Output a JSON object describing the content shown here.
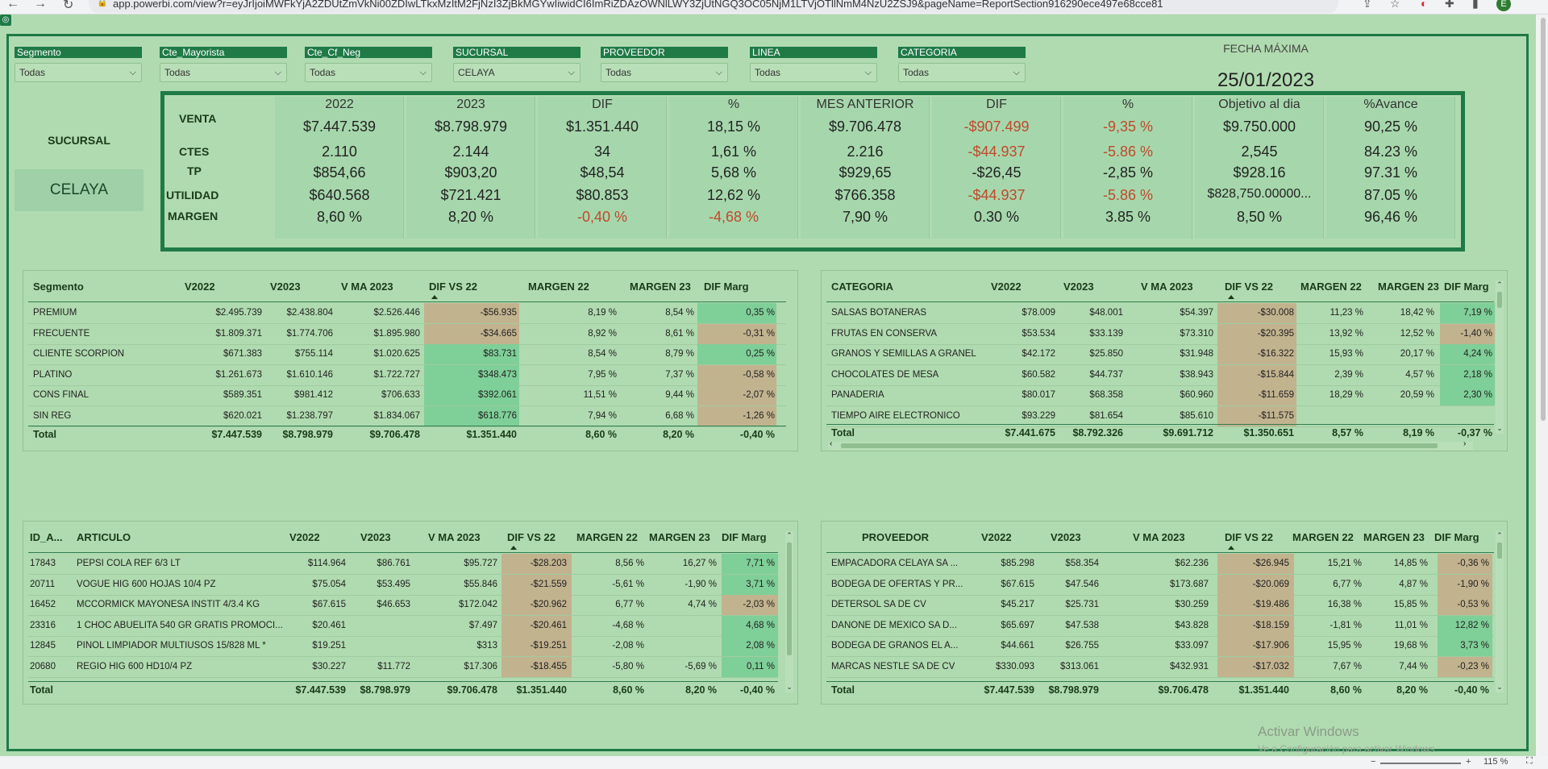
{
  "browser": {
    "url": "app.powerbi.com/view?r=eyJrIjoiMWFkYjA2ZDUtZmVkNi00ZDIwLTkxMzItM2FjNzI3ZjBkMGYwIiwidCI6ImRiZDAzOWNlLWY3ZjUtNGQ3OC05NjM1LTVjOTllNmM4NzU2ZSJ9&pageName=ReportSection916290ece497e68cce81",
    "avatar_letter": "E",
    "zoom": "115 %"
  },
  "slicers": [
    {
      "label": "Segmento",
      "value": "Todas"
    },
    {
      "label": "Cte_Mayorista",
      "value": "Todas"
    },
    {
      "label": "Cte_Cf_Neg",
      "value": "Todas"
    },
    {
      "label": "SUCURSAL",
      "value": "CELAYA"
    },
    {
      "label": "PROVEEDOR",
      "value": "Todas"
    },
    {
      "label": "LINEA",
      "value": "Todas"
    },
    {
      "label": "CATEGORIA",
      "value": "Todas"
    }
  ],
  "fecha": {
    "label": "FECHA MÁXIMA",
    "value": "25/01/2023"
  },
  "sucursal": {
    "label": "SUCURSAL",
    "value": "CELAYA"
  },
  "kpi": {
    "headers": [
      "2022",
      "2023",
      "DIF",
      "%",
      "MES ANTERIOR",
      "DIF",
      "%",
      "Objetivo al dia",
      "%Avance"
    ],
    "rows": [
      {
        "label": "VENTA",
        "values": [
          "$7.447.539",
          "$8.798.979",
          "$1.351.440",
          "18,15 %",
          "$9.706.478",
          "-$907.499",
          "-9,35 %",
          "$9.750.000",
          "90,25 %"
        ],
        "neg": [
          false,
          false,
          false,
          false,
          false,
          true,
          true,
          false,
          false
        ]
      },
      {
        "label": "CTES",
        "values": [
          "2.110",
          "2.144",
          "34",
          "1,61 %",
          "2.216",
          "-$44.937",
          "-5.86 %",
          "2,545",
          "84.23 %"
        ],
        "neg": [
          false,
          false,
          false,
          false,
          false,
          true,
          true,
          false,
          false
        ]
      },
      {
        "label": "TP",
        "values": [
          "$854,66",
          "$903,20",
          "$48,54",
          "5,68 %",
          "$929,65",
          "-$26,45",
          "-2,85 %",
          "$928.16",
          "97.31 %"
        ],
        "neg": [
          false,
          false,
          false,
          false,
          false,
          false,
          false,
          false,
          false
        ]
      },
      {
        "label": "UTILIDAD",
        "values": [
          "$640.568",
          "$721.421",
          "$80.853",
          "12,62 %",
          "$766.358",
          "-$44.937",
          "-5.86 %",
          "$828,750.00000...",
          "87.05 %"
        ],
        "neg": [
          false,
          false,
          false,
          false,
          false,
          true,
          true,
          false,
          false
        ]
      },
      {
        "label": "MARGEN",
        "values": [
          "8,60 %",
          "8,20 %",
          "-0,40 %",
          "-4,68 %",
          "7,90 %",
          "0.30 %",
          "3.85 %",
          "8,50 %",
          "96,46 %"
        ],
        "neg": [
          false,
          false,
          true,
          true,
          false,
          false,
          false,
          false,
          false
        ]
      }
    ]
  },
  "segmento_table": {
    "headers": [
      "Segmento",
      "V2022",
      "V2023",
      "V MA 2023",
      "DIF VS 22",
      "MARGEN 22",
      "MARGEN 23",
      "DIF Marg"
    ],
    "rows": [
      [
        "PREMIUM",
        "$2.495.739",
        "$2.438.804",
        "$2.526.446",
        "-$56.935",
        "8,19 %",
        "8,54 %",
        "0,35 %"
      ],
      [
        "FRECUENTE",
        "$1.809.371",
        "$1.774.706",
        "$1.895.980",
        "-$34.665",
        "8,92 %",
        "8,61 %",
        "-0,31 %"
      ],
      [
        "CLIENTE SCORPION",
        "$671.383",
        "$755.114",
        "$1.020.625",
        "$83.731",
        "8,54 %",
        "8,79 %",
        "0,25 %"
      ],
      [
        "PLATINO",
        "$1.261.673",
        "$1.610.146",
        "$1.722.727",
        "$348.473",
        "7,95 %",
        "7,37 %",
        "-0,58 %"
      ],
      [
        "CONS FINAL",
        "$589.351",
        "$981.412",
        "$706.633",
        "$392.061",
        "11,51 %",
        "9,44 %",
        "-2,07 %"
      ],
      [
        "SIN REG",
        "$620.021",
        "$1.238.797",
        "$1.834.067",
        "$618.776",
        "7,94 %",
        "6,68 %",
        "-1,26 %"
      ]
    ],
    "total": [
      "Total",
      "$7.447.539",
      "$8.798.979",
      "$9.706.478",
      "$1.351.440",
      "8,60 %",
      "8,20 %",
      "-0,40 %"
    ]
  },
  "categoria_table": {
    "headers": [
      "CATEGORIA",
      "V2022",
      "V2023",
      "V MA 2023",
      "DIF VS 22",
      "MARGEN 22",
      "MARGEN 23",
      "DIF Marg"
    ],
    "rows": [
      [
        "SALSAS BOTANERAS",
        "$78.009",
        "$48.001",
        "$54.397",
        "-$30.008",
        "11,23 %",
        "18,42 %",
        "7,19 %"
      ],
      [
        "FRUTAS EN CONSERVA",
        "$53.534",
        "$33.139",
        "$73.310",
        "-$20.395",
        "13,92 %",
        "12,52 %",
        "-1,40 %"
      ],
      [
        "GRANOS Y SEMILLAS A GRANEL",
        "$42.172",
        "$25.850",
        "$31.948",
        "-$16.322",
        "15,93 %",
        "20,17 %",
        "4,24 %"
      ],
      [
        "CHOCOLATES DE MESA",
        "$60.582",
        "$44.737",
        "$38.943",
        "-$15.844",
        "2,39 %",
        "4,57 %",
        "2,18 %"
      ],
      [
        "PANADERIA",
        "$80.017",
        "$68.358",
        "$60.960",
        "-$11.659",
        "18,29 %",
        "20,59 %",
        "2,30 %"
      ],
      [
        "TIEMPO AIRE ELECTRONICO",
        "$93.229",
        "$81.654",
        "$85.610",
        "-$11.575",
        "",
        "",
        ""
      ]
    ],
    "total": [
      "Total",
      "$7.441.675",
      "$8.792.326",
      "$9.691.712",
      "$1.350.651",
      "8,57 %",
      "8,19 %",
      "-0,37 %"
    ]
  },
  "articulo_table": {
    "headers": [
      "ID_A...",
      "ARTICULO",
      "V2022",
      "V2023",
      "V MA 2023",
      "DIF VS 22",
      "MARGEN 22",
      "MARGEN 23",
      "DIF Marg"
    ],
    "rows": [
      [
        "17843",
        "PEPSI COLA REF 6/3 LT",
        "$114.964",
        "$86.761",
        "$95.727",
        "-$28.203",
        "8,56 %",
        "16,27 %",
        "7,71 %"
      ],
      [
        "20711",
        "VOGUE HIG 600 HOJAS 10/4 PZ",
        "$75.054",
        "$53.495",
        "$55.846",
        "-$21.559",
        "-5,61 %",
        "-1,90 %",
        "3,71 %"
      ],
      [
        "16452",
        "MCCORMICK MAYONESA INSTIT 4/3.4 KG",
        "$67.615",
        "$46.653",
        "$172.042",
        "-$20.962",
        "6,77 %",
        "4,74 %",
        "-2,03 %"
      ],
      [
        "23316",
        "1 CHOC ABUELITA 540 GR GRATIS PROMOCI...",
        "$20.461",
        "",
        "$7.497",
        "-$20.461",
        "-4,68 %",
        "",
        "4,68 %"
      ],
      [
        "12845",
        "PINOL LIMPIADOR MULTIUSOS 15/828 ML *",
        "$19.251",
        "",
        "$313",
        "-$19.251",
        "-2,08 %",
        "",
        "2,08 %"
      ],
      [
        "20680",
        "REGIO HIG 600 HD10/4 PZ",
        "$30.227",
        "$11.772",
        "$17.306",
        "-$18.455",
        "-5,80 %",
        "-5,69 %",
        "0,11 %"
      ]
    ],
    "total": [
      "Total",
      "",
      "$7.447.539",
      "$8.798.979",
      "$9.706.478",
      "$1.351.440",
      "8,60 %",
      "8,20 %",
      "-0,40 %"
    ]
  },
  "proveedor_table": {
    "headers": [
      "PROVEEDOR",
      "V2022",
      "V2023",
      "V MA 2023",
      "DIF VS 22",
      "MARGEN 22",
      "MARGEN 23",
      "DIF Marg"
    ],
    "rows": [
      [
        "EMPACADORA CELAYA SA ...",
        "$85.298",
        "$58.354",
        "$62.236",
        "-$26.945",
        "15,21 %",
        "14,85 %",
        "-0,36 %"
      ],
      [
        "BODEGA DE OFERTAS Y PR...",
        "$67.615",
        "$47.546",
        "$173.687",
        "-$20.069",
        "6,77 %",
        "4,87 %",
        "-1,90 %"
      ],
      [
        "DETERSOL SA DE CV",
        "$45.217",
        "$25.731",
        "$30.259",
        "-$19.486",
        "16,38 %",
        "15,85 %",
        "-0,53 %"
      ],
      [
        "DANONE DE MEXICO SA D...",
        "$65.697",
        "$47.538",
        "$43.828",
        "-$18.159",
        "-1,81 %",
        "11,01 %",
        "12,82 %"
      ],
      [
        "BODEGA DE GRANOS EL A...",
        "$44.661",
        "$26.755",
        "$33.097",
        "-$17.906",
        "15,95 %",
        "19,68 %",
        "3,73 %"
      ],
      [
        "MARCAS NESTLE SA DE CV",
        "$330.093",
        "$313.061",
        "$432.931",
        "-$17.032",
        "7,67 %",
        "7,44 %",
        "-0,23 %"
      ]
    ],
    "total": [
      "Total",
      "$7.447.539",
      "$8.798.979",
      "$9.706.478",
      "$1.351.440",
      "8,60 %",
      "8,20 %",
      "-0,40 %"
    ]
  },
  "watermark": {
    "line1": "Activar Windows",
    "line2": "Ve a Configuración para activar Windows."
  },
  "colors": {
    "page_bg": "#b0dbb0",
    "accent": "#1f7a46",
    "negative": "#c0492b",
    "cell_green": "#7fcf98",
    "cell_tan": "#c2b38f"
  }
}
